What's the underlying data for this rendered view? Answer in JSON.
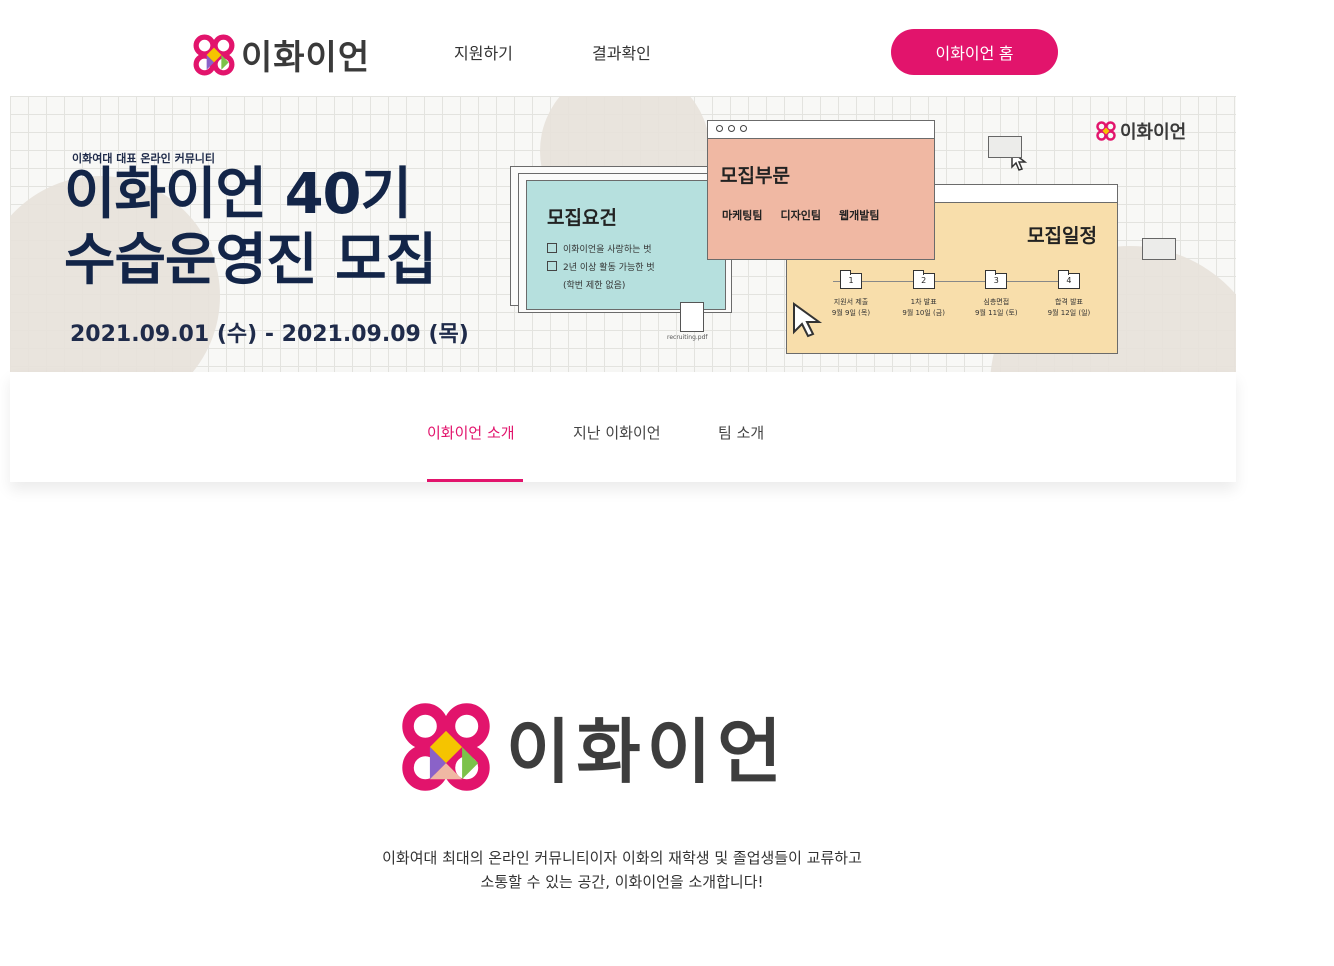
{
  "brand": {
    "name": "이화이언",
    "colors": {
      "primary": "#e2146c",
      "navy": "#132548",
      "teal": "#b6e0de",
      "salmon": "#f0b8a3",
      "sand": "#f8deab"
    }
  },
  "nav": {
    "links": [
      "지원하기",
      "결과확인"
    ],
    "home_button": "이화이언 홈"
  },
  "banner": {
    "subtitle": "이화여대 대표 온라인 커뮤니티",
    "title_line1": "이화이언 40기",
    "title_line2": "수습운영진 모집",
    "date_range": "2021.09.01 (수) - 2021.09.09 (목)",
    "requirements": {
      "title": "모집요건",
      "items": [
        "이화이언을 사랑하는 벗",
        "2년 이상 활동 가능한 벗"
      ],
      "note": "(학번 제한 없음)"
    },
    "parts": {
      "title": "모집부문",
      "teams": [
        "마케팅팀",
        "디자인팀",
        "웹개발팀"
      ]
    },
    "schedule": {
      "title": "모집일정",
      "steps": [
        {
          "num": "1",
          "label": "지원서 제출",
          "date": "9월 9일 (목)"
        },
        {
          "num": "2",
          "label": "1차 발표",
          "date": "9월 10일 (금)"
        },
        {
          "num": "3",
          "label": "심층면접",
          "date": "9월 11일 (토)"
        },
        {
          "num": "4",
          "label": "합격 발표",
          "date": "9월 12일 (일)"
        }
      ]
    },
    "file_label": "recruiting.pdf",
    "mini_logo": "이화이언"
  },
  "tabs": [
    "이화이언 소개",
    "지난 이화이언",
    "팀 소개"
  ],
  "intro": {
    "logo_text": "이화이언",
    "line1": "이화여대 최대의 온라인 커뮤니티이자 이화의 재학생 및 졸업생들이 교류하고",
    "line2": "소통할 수 있는 공간, 이화이언을 소개합니다!"
  }
}
